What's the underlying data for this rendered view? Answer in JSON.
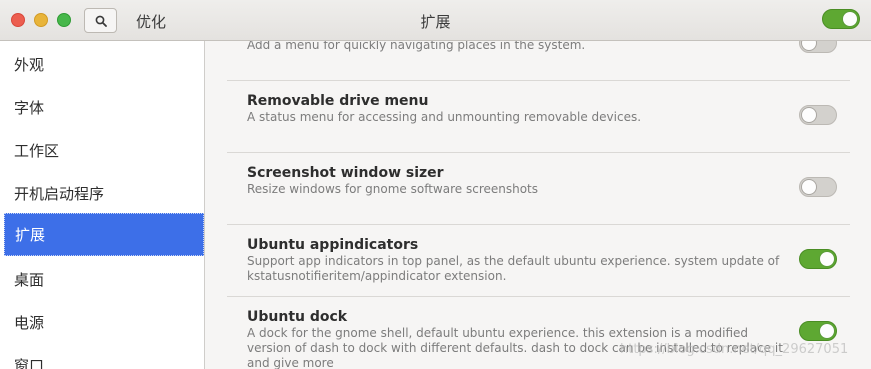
{
  "header": {
    "app_title": "优化",
    "page_title": "扩展",
    "master_switch": "on"
  },
  "sidebar": {
    "items": [
      {
        "label": "外观",
        "selected": false
      },
      {
        "label": "字体",
        "selected": false
      },
      {
        "label": "工作区",
        "selected": false
      },
      {
        "label": "开机启动程序",
        "selected": false
      },
      {
        "label": "扩展",
        "selected": true
      },
      {
        "label": "桌面",
        "selected": false
      },
      {
        "label": "电源",
        "selected": false
      },
      {
        "label": "窗口",
        "selected": false
      }
    ]
  },
  "extensions": [
    {
      "name": "",
      "description": "Add a menu for quickly navigating places in the system.",
      "enabled": false
    },
    {
      "name": "Removable drive menu",
      "description": "A status menu for accessing and unmounting removable devices.",
      "enabled": false
    },
    {
      "name": "Screenshot window sizer",
      "description": "Resize windows for gnome software screenshots",
      "enabled": false
    },
    {
      "name": "Ubuntu appindicators",
      "description": "Support app indicators in top panel, as the default ubuntu experience. system update of kstatusnotifieritem/appindicator extension.",
      "enabled": true
    },
    {
      "name": "Ubuntu dock",
      "description": "A dock for the gnome shell, default ubuntu experience. this extension is a modified version of dash to dock with different defaults. dash to dock can be installed to replace it and give more",
      "enabled": true
    }
  ],
  "watermark": "https://blog.csdn.net/qq_29627051",
  "colors": {
    "accent": "#3d6fe8",
    "switch_on": "#5ea832",
    "switch_off": "#d3d1cd"
  }
}
